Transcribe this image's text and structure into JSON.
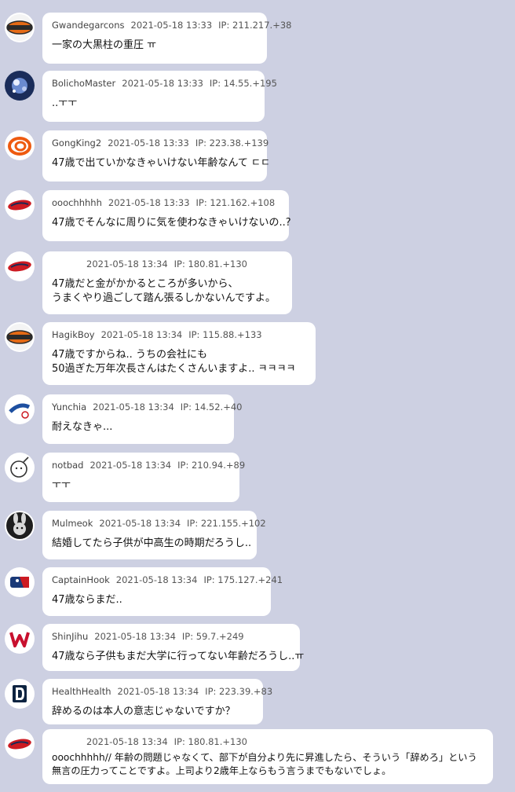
{
  "comments": [
    {
      "nick": "Gwandegarcons",
      "date": "2021-05-18 13:33",
      "ip": "IP: 211.217.+38",
      "lines": [
        "一家の大黒柱の重圧 ㅠ"
      ],
      "avatar": "orange-baseball-team-logo-icon"
    },
    {
      "nick": "BolichoMaster",
      "date": "2021-05-18 13:33",
      "ip": "IP: 14.55.+195",
      "lines": [
        "..ㅜㅜ"
      ],
      "avatar": "sparkle-avatar-icon"
    },
    {
      "nick": "GongKing2",
      "date": "2021-05-18 13:33",
      "ip": "IP: 223.38.+139",
      "lines": [
        "47歳で出ていかなきゃいけない年齢なんて ㄷㄷ"
      ],
      "avatar": "orange-swirl-logo-icon"
    },
    {
      "nick": "ooochhhhh",
      "date": "2021-05-18 13:33",
      "ip": "IP: 121.162.+108",
      "lines": [
        "47歳でそんなに周りに気を使わなきゃいけないの..?"
      ],
      "avatar": "red-script-team-logo-icon"
    },
    {
      "nick": "",
      "date": "2021-05-18 13:34",
      "ip": "IP: 180.81.+130",
      "lines": [
        "47歳だと金がかかるところが多いから、",
        "うまくやり過ごして踏ん張るしかないんですよ。"
      ],
      "avatar": "red-script-team-logo-icon"
    },
    {
      "nick": "HagikBoy",
      "date": "2021-05-18 13:34",
      "ip": "IP: 115.88.+133",
      "lines": [
        "47歳ですからね.. うちの会社にも",
        "50過ぎた万年次長さんはたくさんいますよ.. ㅋㅋㅋㅋ"
      ],
      "avatar": "orange-baseball-team-logo-icon"
    },
    {
      "nick": "Yunchia",
      "date": "2021-05-18 13:34",
      "ip": "IP: 14.52.+40",
      "lines": [
        "耐えなきゃ..."
      ],
      "avatar": "blue-script-ball-logo-icon"
    },
    {
      "nick": "notbad",
      "date": "2021-05-18 13:34",
      "ip": "IP: 210.94.+89",
      "lines": [
        "ㅜㅜ"
      ],
      "avatar": "doodle-face-avatar-icon"
    },
    {
      "nick": "Mulmeok",
      "date": "2021-05-18 13:34",
      "ip": "IP: 221.155.+102",
      "lines": [
        "結婚してたら子供が中高生の時期だろうし.."
      ],
      "avatar": "bunny-avatar-icon"
    },
    {
      "nick": "CaptainHook",
      "date": "2021-05-18 13:34",
      "ip": "IP: 175.127.+241",
      "lines": [
        "47歳ならまだ.."
      ],
      "avatar": "league-shield-logo-icon"
    },
    {
      "nick": "ShinJihu",
      "date": "2021-05-18 13:34",
      "ip": "IP: 59.7.+249",
      "lines": [
        "47歳なら子供もまだ大学に行ってない年齢だろうし..ㅠ"
      ],
      "avatar": "red-w-logo-icon"
    },
    {
      "nick": "HealthHealth",
      "date": "2021-05-18 13:34",
      "ip": "IP: 223.39.+83",
      "lines": [
        "辞めるのは本人の意志じゃないですか？"
      ],
      "avatar": "navy-d-logo-icon"
    },
    {
      "nick": "",
      "date": "2021-05-18 13:34",
      "ip": "IP: 180.81.+130",
      "lines": [
        "ooochhhhh// 年齢の問題じゃなくて、部下が自分より先に昇進したら、そういう「辞めろ」という",
        "無言の圧力ってことですよ。上司より2歳年上ならもう言うまでもないでしょ。"
      ],
      "avatar": "red-script-team-logo-icon"
    }
  ]
}
